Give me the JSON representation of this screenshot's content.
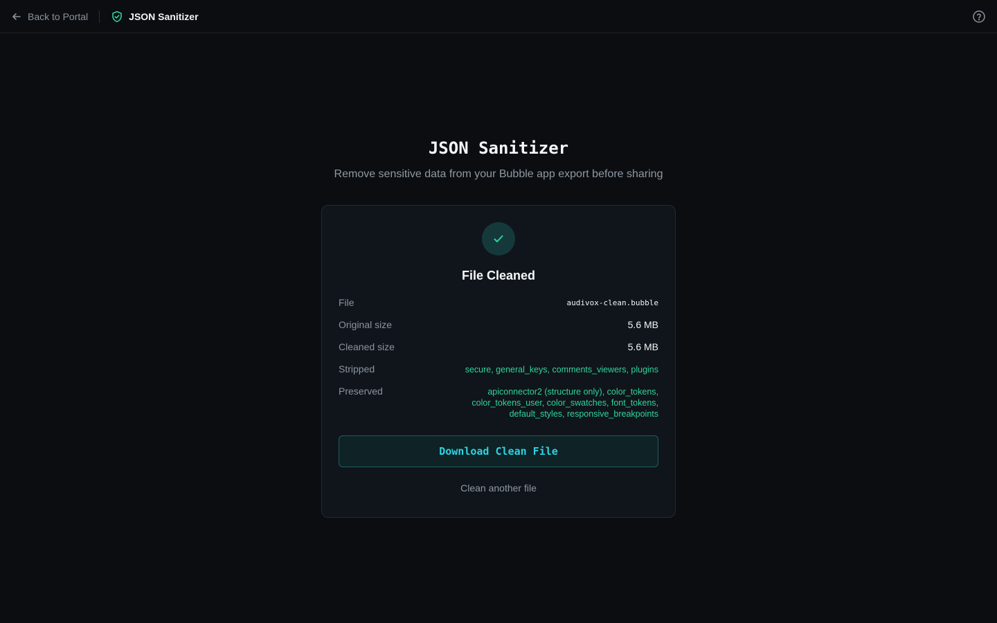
{
  "topbar": {
    "back_label": "Back to Portal",
    "app_title": "JSON Sanitizer",
    "back_icon": "arrow-left-icon",
    "app_icon": "shield-check-icon",
    "help_icon": "help-circle-icon"
  },
  "hero": {
    "title": "JSON Sanitizer",
    "subtitle": "Remove sensitive data from your Bubble app export before sharing"
  },
  "result": {
    "status_icon": "check-icon",
    "title": "File Cleaned",
    "rows": [
      {
        "label": "File",
        "value": "audivox-clean.bubble"
      },
      {
        "label": "Original size",
        "value": "5.6 MB"
      },
      {
        "label": "Cleaned size",
        "value": "5.6 MB"
      },
      {
        "label": "Stripped",
        "value": "secure, general_keys, comments_viewers, plugins"
      },
      {
        "label": "Preserved",
        "value": "apiconnector2 (structure only), color_tokens, color_tokens_user, color_swatches, font_tokens, default_styles, responsive_breakpoints"
      }
    ],
    "download_label": "Download Clean File",
    "clean_another_label": "Clean another file"
  },
  "colors": {
    "background": "#0b0d11",
    "card": "#10151b",
    "accent_cyan": "#2bd3e0",
    "accent_green": "#2fd49a",
    "check_circle": "#15393a"
  }
}
